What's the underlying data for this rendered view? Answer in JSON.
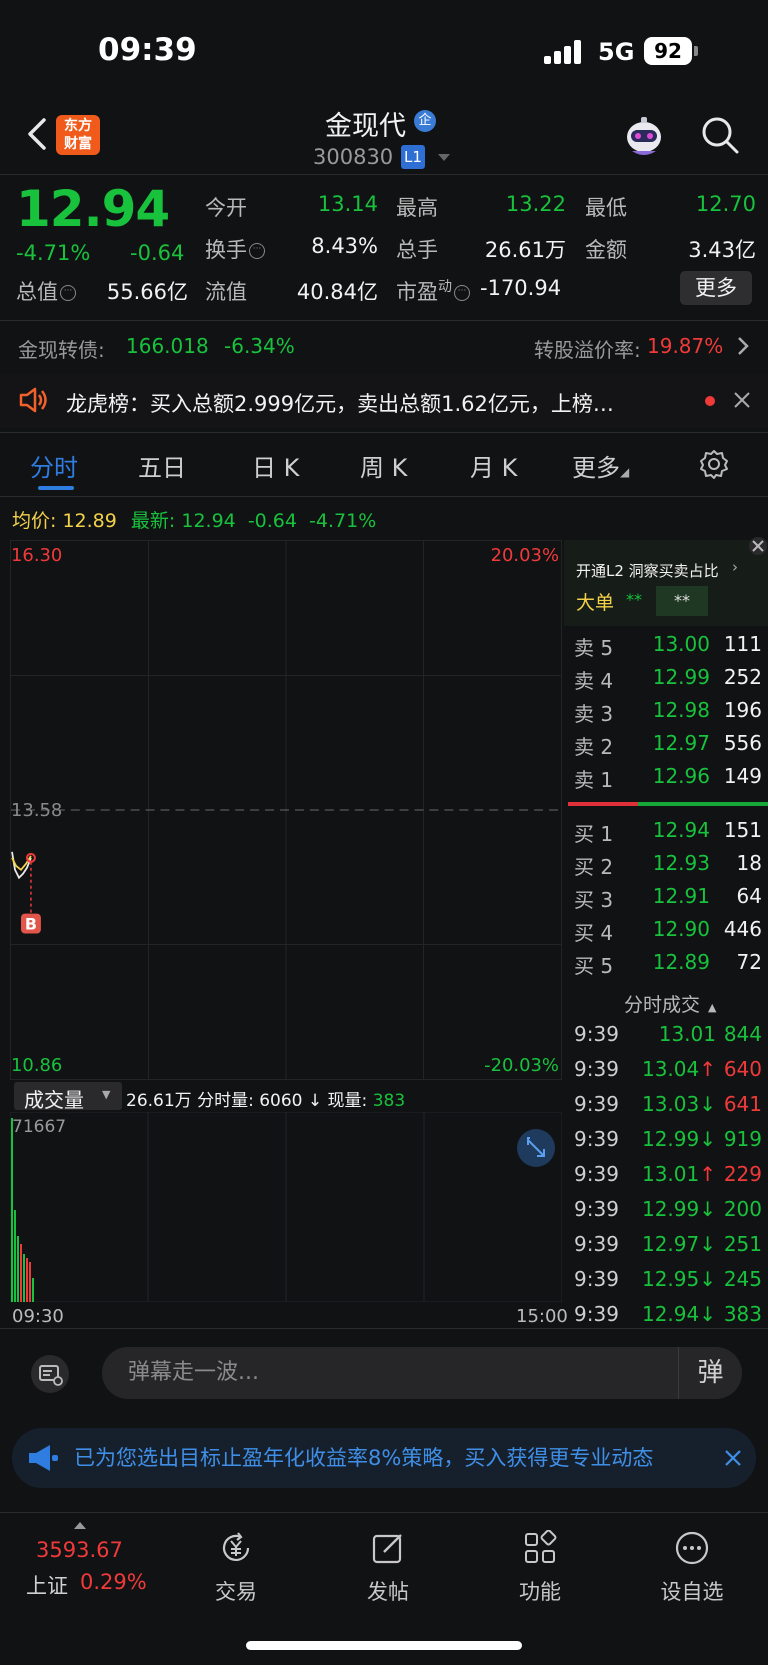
{
  "status": {
    "time": "09:39",
    "network": "5G",
    "battery": "92"
  },
  "header": {
    "brand": [
      "东方",
      "财富"
    ],
    "name": "金现代",
    "ent_badge": "企",
    "code": "300830",
    "level": "L1"
  },
  "quote": {
    "price": "12.94",
    "pct": "-4.71%",
    "chg": "-0.64",
    "open_label": "今开",
    "open": "13.14",
    "high_label": "最高",
    "high": "13.22",
    "low_label": "最低",
    "low": "12.70",
    "turnover_label": "换手",
    "turnover": "8.43%",
    "vol_label": "总手",
    "vol": "26.61万",
    "amount_label": "金额",
    "amount": "3.43亿",
    "mcap_label": "总值",
    "mcap": "55.66亿",
    "float_label": "流值",
    "float": "40.84亿",
    "pe_label": "市盈",
    "pe_sup": "动",
    "pe": "-170.94",
    "more": "更多"
  },
  "convertible": {
    "label": "金现转债:",
    "price": "166.018",
    "pct": "-6.34%",
    "premium_label": "转股溢价率:",
    "premium": "19.87%"
  },
  "notice": {
    "text": "龙虎榜：买入总额2.999亿元，卖出总额1.62亿元，上榜…"
  },
  "tabs": [
    "分时",
    "五日",
    "日 K",
    "周 K",
    "月 K",
    "更多"
  ],
  "avg": {
    "label": "均价:",
    "value": "12.89",
    "latest_label": "最新:",
    "latest": "12.94",
    "chg": "-0.64",
    "pct": "-4.71%"
  },
  "chart": {
    "y_top": "16.30",
    "y_mid": "13.58",
    "y_bottom": "10.86",
    "pct_top": "20.03%",
    "pct_bottom": "-20.03%",
    "marker": "B",
    "time_start": "09:30",
    "time_end": "15:00"
  },
  "volume": {
    "selector": "成交量",
    "total": "26.61万",
    "period_label": "分时量:",
    "period": "6060",
    "current_label": "现量:",
    "current": "383",
    "max": "71667"
  },
  "orderbook": {
    "l2_text": "开通L2 洞察买卖占比",
    "big_label": "大单",
    "big_a": "**",
    "big_b": "**",
    "asks": [
      {
        "label": "卖 5",
        "price": "13.00",
        "vol": "111"
      },
      {
        "label": "卖 4",
        "price": "12.99",
        "vol": "252"
      },
      {
        "label": "卖 3",
        "price": "12.98",
        "vol": "196"
      },
      {
        "label": "卖 2",
        "price": "12.97",
        "vol": "556"
      },
      {
        "label": "卖 1",
        "price": "12.96",
        "vol": "149"
      }
    ],
    "bids": [
      {
        "label": "买 1",
        "price": "12.94",
        "vol": "151"
      },
      {
        "label": "买 2",
        "price": "12.93",
        "vol": "18"
      },
      {
        "label": "买 3",
        "price": "12.91",
        "vol": "64"
      },
      {
        "label": "买 4",
        "price": "12.90",
        "vol": "446"
      },
      {
        "label": "买 5",
        "price": "12.89",
        "vol": "72"
      }
    ],
    "trades_title": "分时成交",
    "trades": [
      {
        "time": "9:39",
        "price": "13.01",
        "arrow": "",
        "vol": "844",
        "vol_color": "green"
      },
      {
        "time": "9:39",
        "price": "13.04",
        "arrow": "↑",
        "vol": "640",
        "vol_color": "red"
      },
      {
        "time": "9:39",
        "price": "13.03",
        "arrow": "↓",
        "vol": "641",
        "vol_color": "red"
      },
      {
        "time": "9:39",
        "price": "12.99",
        "arrow": "↓",
        "vol": "919",
        "vol_color": "green"
      },
      {
        "time": "9:39",
        "price": "13.01",
        "arrow": "↑",
        "vol": "229",
        "vol_color": "red"
      },
      {
        "time": "9:39",
        "price": "12.99",
        "arrow": "↓",
        "vol": "200",
        "vol_color": "green"
      },
      {
        "time": "9:39",
        "price": "12.97",
        "arrow": "↓",
        "vol": "251",
        "vol_color": "green"
      },
      {
        "time": "9:39",
        "price": "12.95",
        "arrow": "↓",
        "vol": "245",
        "vol_color": "green"
      },
      {
        "time": "9:39",
        "price": "12.94",
        "arrow": "↓",
        "vol": "383",
        "vol_color": "green"
      }
    ]
  },
  "comment": {
    "placeholder": "弹幕走一波...",
    "button": "弹"
  },
  "ad": {
    "text": "已为您选出目标止盈年化收益率8%策略，买入获得更专业动态"
  },
  "bottom_nav": {
    "index_value": "3593.67",
    "index_name": "上证",
    "index_pct": "0.29%",
    "items": [
      "交易",
      "发帖",
      "功能",
      "设自选"
    ]
  },
  "colors": {
    "up": "#f03a3a",
    "down": "#18c23c",
    "accent": "#2f7de1",
    "avg_line": "#f3d24a"
  }
}
